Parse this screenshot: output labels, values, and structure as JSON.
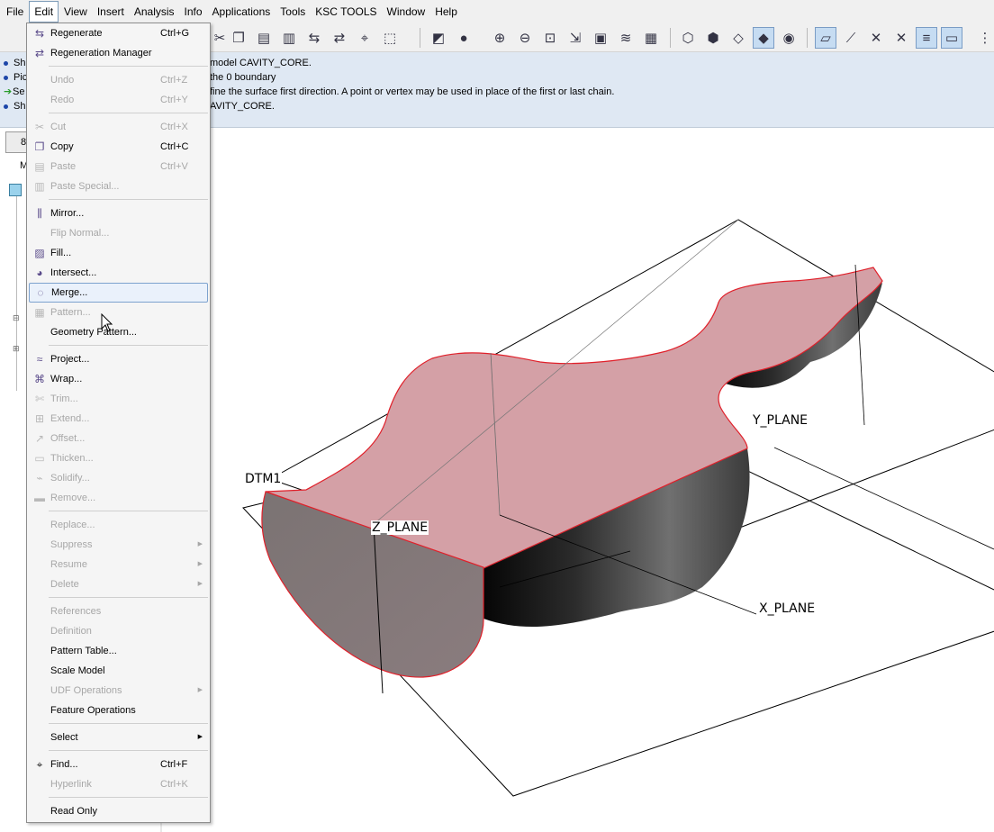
{
  "menubar": {
    "items": [
      "File",
      "Edit",
      "View",
      "Insert",
      "Analysis",
      "Info",
      "Applications",
      "Tools",
      "KSC TOOLS",
      "Window",
      "Help"
    ],
    "active": "Edit"
  },
  "messages": {
    "left": [
      "Sh",
      "Pic",
      "Se",
      "Sh"
    ],
    "right": [
      "model CAVITY_CORE.",
      "the 0 boundary",
      "fine the surface first direction. A point or vertex may be used in place of the first or last chain.",
      "AVITY_CORE."
    ]
  },
  "navigator": {
    "tab_label": "8",
    "label": "M"
  },
  "viewport": {
    "labels": {
      "dtm1": "DTM1",
      "z_plane": "Z_PLANE",
      "y_plane": "Y_PLANE",
      "x_plane": "X_PLANE"
    }
  },
  "edit_menu": {
    "items": [
      {
        "label": "Regenerate",
        "shortcut": "Ctrl+G",
        "enabled": true,
        "icon": "regenerate-icon"
      },
      {
        "label": "Regeneration Manager",
        "shortcut": "",
        "enabled": true,
        "icon": "regeneration-manager-icon"
      },
      {
        "label": "Undo",
        "shortcut": "Ctrl+Z",
        "enabled": false,
        "icon": ""
      },
      {
        "label": "Redo",
        "shortcut": "Ctrl+Y",
        "enabled": false,
        "icon": ""
      },
      {
        "label": "Cut",
        "shortcut": "Ctrl+X",
        "enabled": false,
        "icon": "cut-icon"
      },
      {
        "label": "Copy",
        "shortcut": "Ctrl+C",
        "enabled": true,
        "icon": "copy-icon"
      },
      {
        "label": "Paste",
        "shortcut": "Ctrl+V",
        "enabled": false,
        "icon": "paste-icon"
      },
      {
        "label": "Paste Special...",
        "shortcut": "",
        "enabled": false,
        "icon": "paste-special-icon"
      },
      {
        "label": "Mirror...",
        "shortcut": "",
        "enabled": true,
        "icon": "mirror-icon"
      },
      {
        "label": "Flip Normal...",
        "shortcut": "",
        "enabled": false,
        "icon": ""
      },
      {
        "label": "Fill...",
        "shortcut": "",
        "enabled": true,
        "icon": "fill-icon"
      },
      {
        "label": "Intersect...",
        "shortcut": "",
        "enabled": true,
        "icon": "intersect-icon"
      },
      {
        "label": "Merge...",
        "shortcut": "",
        "enabled": true,
        "icon": "merge-icon"
      },
      {
        "label": "Pattern...",
        "shortcut": "",
        "enabled": false,
        "icon": "pattern-icon"
      },
      {
        "label": "Geometry Pattern...",
        "shortcut": "",
        "enabled": true,
        "icon": ""
      },
      {
        "label": "Project...",
        "shortcut": "",
        "enabled": true,
        "icon": "project-icon"
      },
      {
        "label": "Wrap...",
        "shortcut": "",
        "enabled": true,
        "icon": "wrap-icon"
      },
      {
        "label": "Trim...",
        "shortcut": "",
        "enabled": false,
        "icon": "trim-icon"
      },
      {
        "label": "Extend...",
        "shortcut": "",
        "enabled": false,
        "icon": "extend-icon"
      },
      {
        "label": "Offset...",
        "shortcut": "",
        "enabled": false,
        "icon": "offset-icon"
      },
      {
        "label": "Thicken...",
        "shortcut": "",
        "enabled": false,
        "icon": "thicken-icon"
      },
      {
        "label": "Solidify...",
        "shortcut": "",
        "enabled": false,
        "icon": "solidify-icon"
      },
      {
        "label": "Remove...",
        "shortcut": "",
        "enabled": false,
        "icon": "remove-icon"
      },
      {
        "label": "Replace...",
        "shortcut": "",
        "enabled": false,
        "icon": ""
      },
      {
        "label": "Suppress",
        "shortcut": "",
        "enabled": false,
        "icon": "",
        "submenu": true
      },
      {
        "label": "Resume",
        "shortcut": "",
        "enabled": false,
        "icon": "",
        "submenu": true
      },
      {
        "label": "Delete",
        "shortcut": "",
        "enabled": false,
        "icon": "",
        "submenu": true
      },
      {
        "label": "References",
        "shortcut": "",
        "enabled": false,
        "icon": ""
      },
      {
        "label": "Definition",
        "shortcut": "",
        "enabled": false,
        "icon": ""
      },
      {
        "label": "Pattern Table...",
        "shortcut": "",
        "enabled": true,
        "icon": ""
      },
      {
        "label": "Scale Model",
        "shortcut": "",
        "enabled": true,
        "icon": ""
      },
      {
        "label": "UDF Operations",
        "shortcut": "",
        "enabled": false,
        "icon": "",
        "submenu": true
      },
      {
        "label": "Feature Operations",
        "shortcut": "",
        "enabled": true,
        "icon": ""
      },
      {
        "label": "Select",
        "shortcut": "",
        "enabled": true,
        "icon": "",
        "submenu": true
      },
      {
        "label": "Find...",
        "shortcut": "Ctrl+F",
        "enabled": true,
        "icon": "find-icon"
      },
      {
        "label": "Hyperlink",
        "shortcut": "Ctrl+K",
        "enabled": false,
        "icon": ""
      },
      {
        "label": "Read Only",
        "shortcut": "",
        "enabled": true,
        "icon": ""
      }
    ],
    "hovered": "Merge..."
  },
  "colors": {
    "surface_fill": "#d4a0a6",
    "surface_edge": "#e0202a",
    "bg_message": "#dfe8f3",
    "menu_bg": "#f5f5f5"
  }
}
